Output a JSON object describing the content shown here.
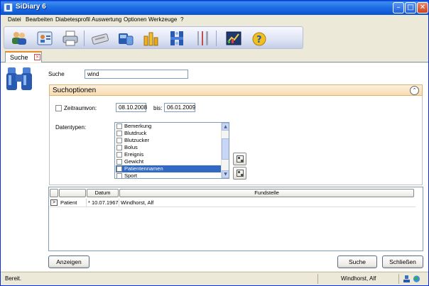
{
  "window": {
    "title": "SiDiary 6"
  },
  "menu": [
    "Datei",
    "Bearbeiten",
    "Diabetesprofil",
    "Auswertung",
    "Optionen",
    "Werkzeuge",
    "?"
  ],
  "toolbar_icons": [
    "users-icon",
    "profile-card-icon",
    "printer-icon",
    "keyboard-icon",
    "device-icon",
    "statistics-icon",
    "network-icon",
    "food-icon",
    "chart-image-icon",
    "help-icon"
  ],
  "tab": {
    "label": "Suche"
  },
  "search": {
    "label": "Suche",
    "value": "wind"
  },
  "options": {
    "title": "Suchoptionen",
    "zeitraum_label": "Zeitraum",
    "von_label": "von:",
    "von_value": "08.10.2008",
    "bis_label": "bis:",
    "bis_value": "06.01.2009",
    "datentypen_label": "Datentypen:",
    "datentypen": [
      {
        "label": "Bemerkung",
        "checked": false,
        "selected": false
      },
      {
        "label": "Blutdruck",
        "checked": false,
        "selected": false
      },
      {
        "label": "Blutzucker",
        "checked": false,
        "selected": false
      },
      {
        "label": "Bolus",
        "checked": false,
        "selected": false
      },
      {
        "label": "Ereignis",
        "checked": false,
        "selected": false
      },
      {
        "label": "Gewicht",
        "checked": false,
        "selected": false
      },
      {
        "label": "Patientennamen",
        "checked": true,
        "selected": true
      },
      {
        "label": "Sport",
        "checked": false,
        "selected": false
      }
    ]
  },
  "results": {
    "columns": [
      "",
      "",
      "Datum",
      "Fundstelle"
    ],
    "rows": [
      {
        "marker": ">",
        "type": "Patient",
        "datum": "* 10.07.1967",
        "fundstelle": "Windhorst, Alf"
      }
    ]
  },
  "buttons": {
    "anzeigen": "Anzeigen",
    "suche": "Suche",
    "schliessen": "Schließen"
  },
  "status": {
    "left": "Bereit.",
    "user": "Windhorst, Alf"
  }
}
